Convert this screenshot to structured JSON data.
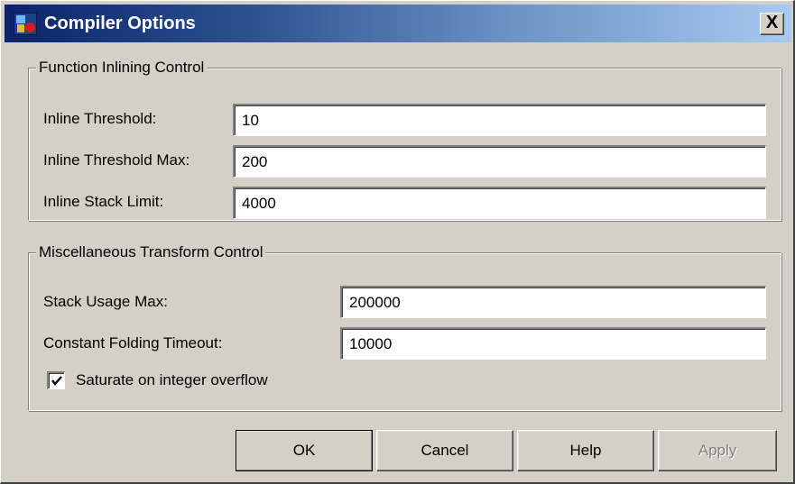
{
  "window": {
    "title": "Compiler Options",
    "close_label": "X",
    "app_icon": "matlab-simulink-icon"
  },
  "inlining": {
    "legend": "Function Inlining Control",
    "fields": [
      {
        "label": "Inline Threshold:",
        "value": "10"
      },
      {
        "label": "Inline Threshold Max:",
        "value": "200"
      },
      {
        "label": "Inline Stack Limit:",
        "value": "4000"
      }
    ]
  },
  "misc": {
    "legend": "Miscellaneous Transform Control",
    "fields": [
      {
        "label": "Stack Usage Max:",
        "value": "200000"
      },
      {
        "label": "Constant Folding Timeout:",
        "value": "10000"
      }
    ],
    "saturate": {
      "label": "Saturate on integer overflow",
      "checked": true
    }
  },
  "buttons": {
    "ok": "OK",
    "cancel": "Cancel",
    "help": "Help",
    "apply": "Apply"
  },
  "colors": {
    "title_start": "#0a246a",
    "title_end": "#a6caf0",
    "face": "#d4d0c8"
  }
}
